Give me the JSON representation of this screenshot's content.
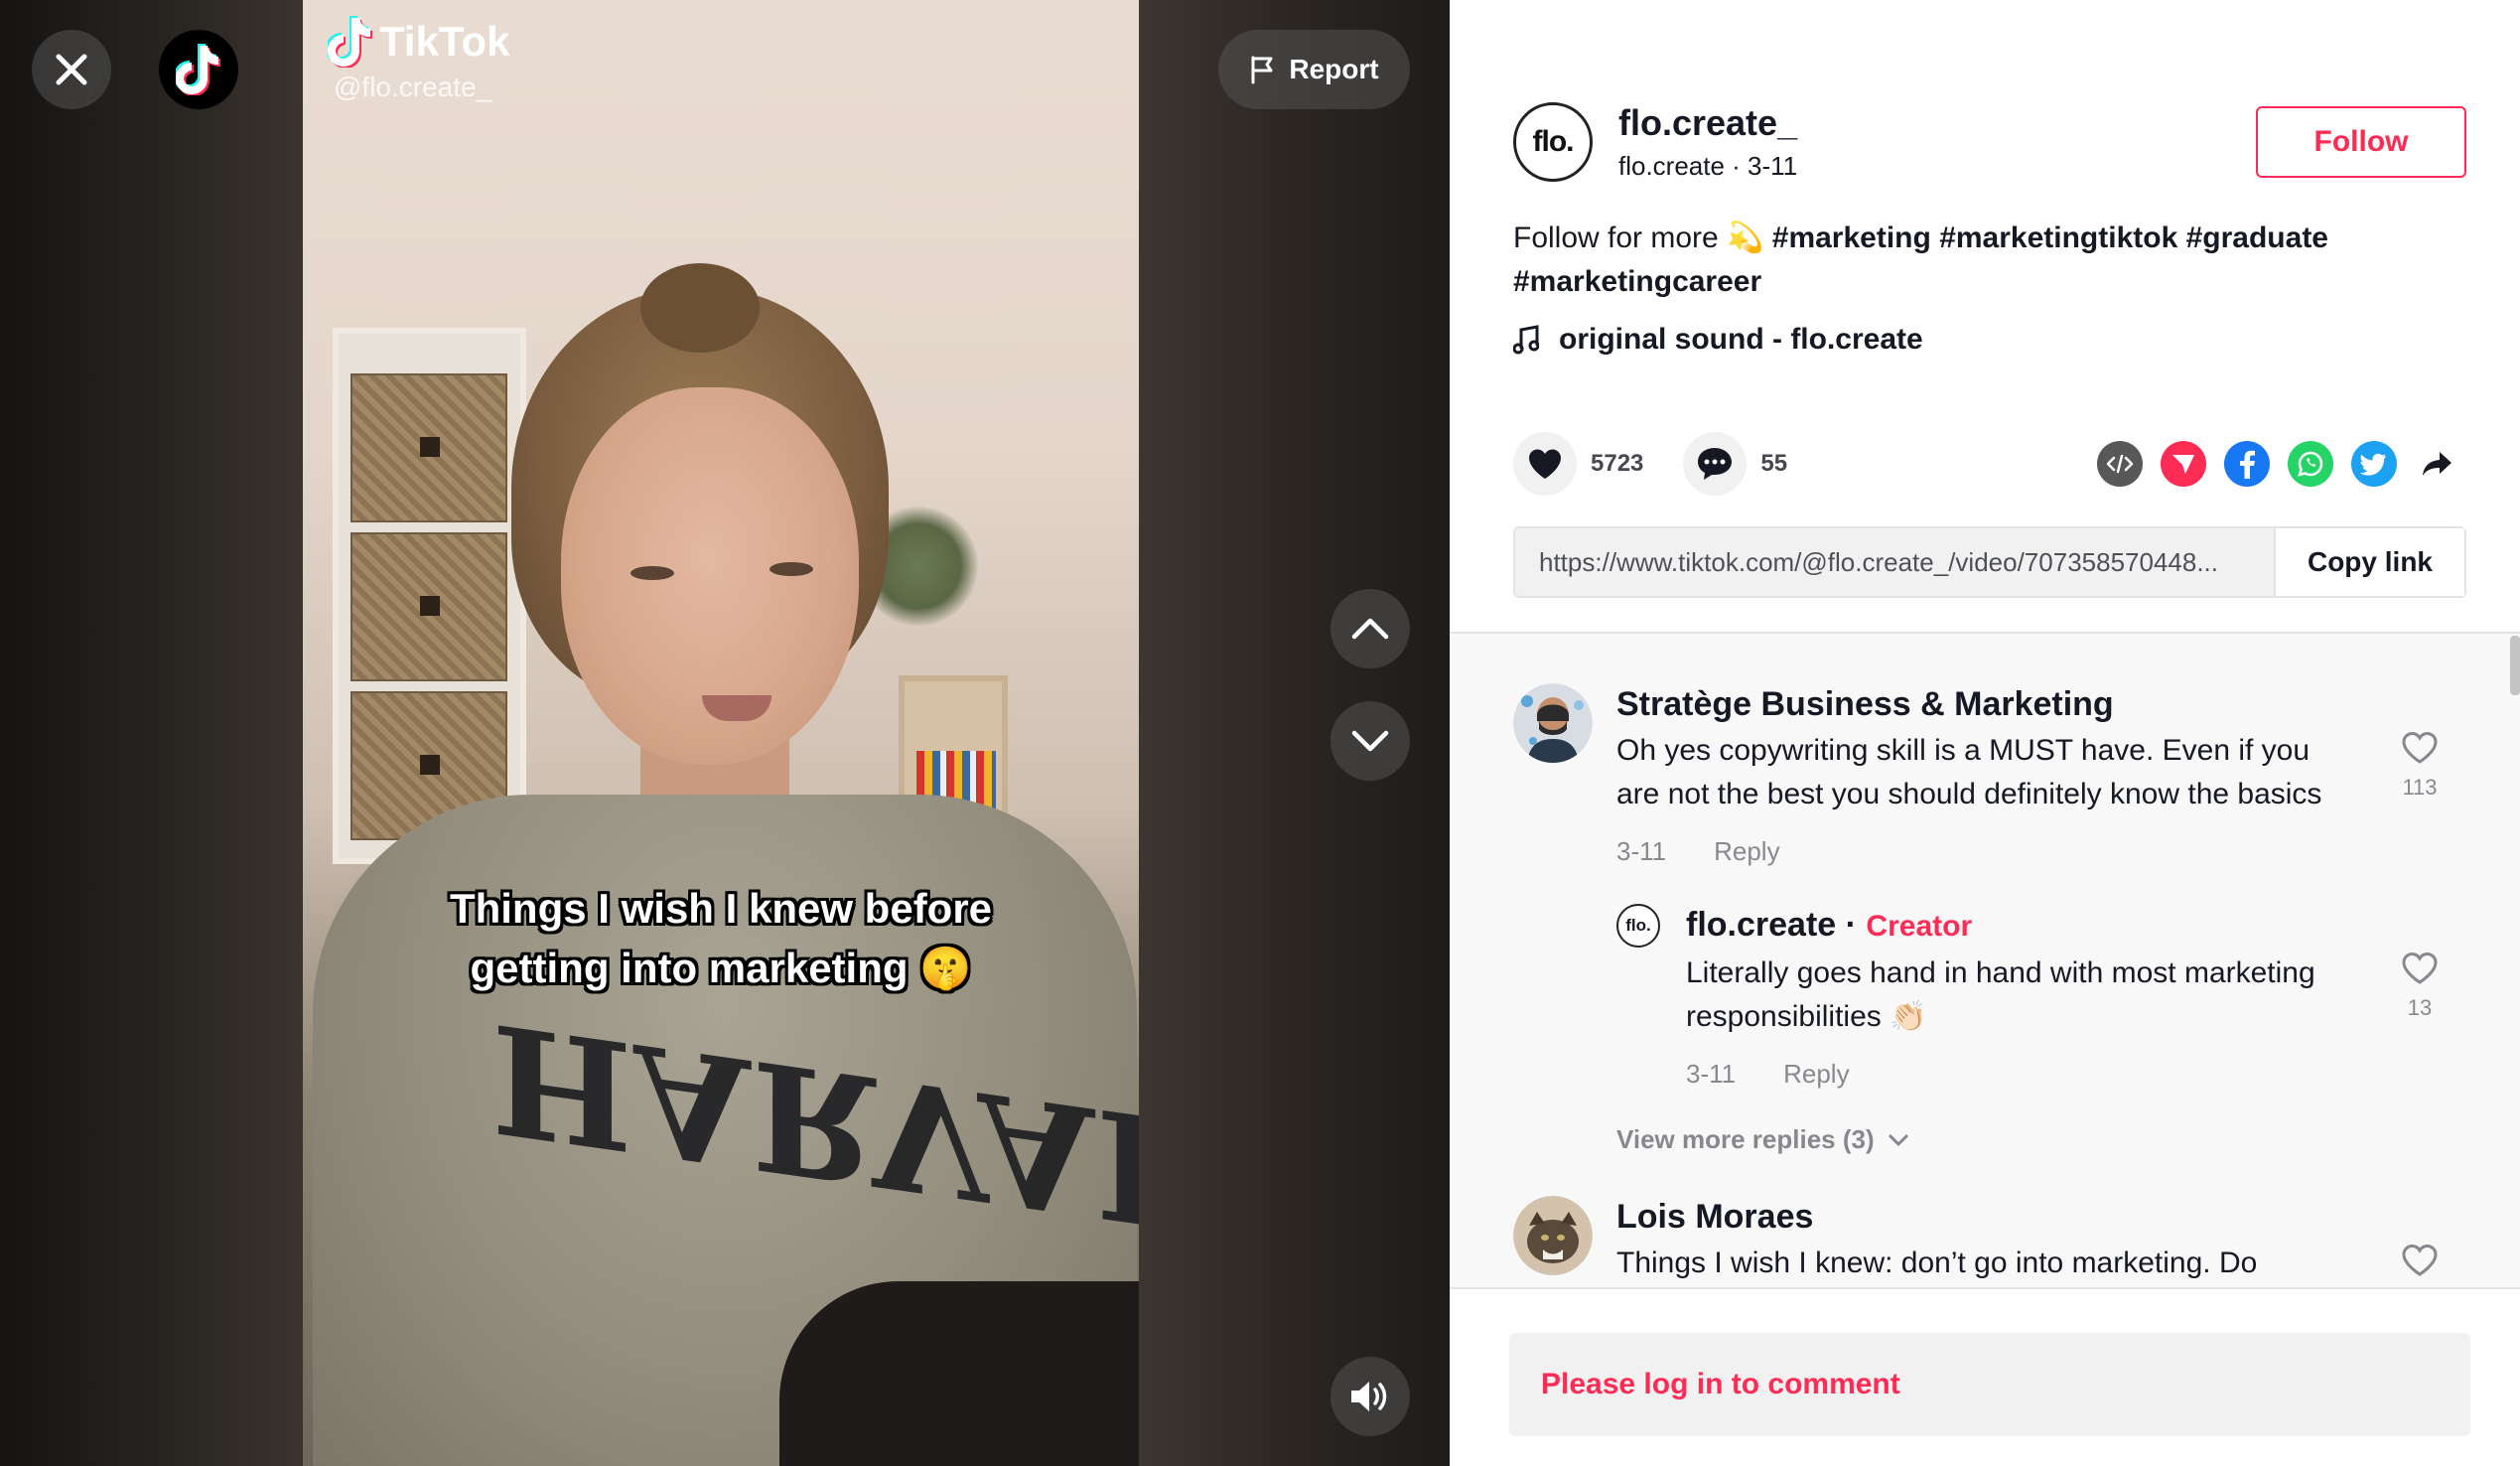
{
  "video": {
    "watermark_brand": "TikTok",
    "watermark_user": "@flo.create_",
    "caption_line1": "Things I wish I knew before",
    "caption_line2": "getting into marketing 🤫",
    "report_label": "Report"
  },
  "author": {
    "avatar_text": "flo.",
    "username": "flo.create_",
    "subline": "flo.create · 3-11",
    "follow_label": "Follow"
  },
  "description": {
    "text": "Follow for more 💫",
    "hashtags": [
      "#marketing",
      "#marketingtiktok",
      "#graduate",
      "#marketingcareer"
    ]
  },
  "sound": {
    "label": "original sound - flo.create"
  },
  "stats": {
    "likes": "5723",
    "comments": "55"
  },
  "share_icons": [
    "embed-icon",
    "send-icon",
    "facebook-icon",
    "whatsapp-icon",
    "twitter-icon",
    "share-arrow-icon"
  ],
  "link": {
    "url": "https://www.tiktok.com/@flo.create_/video/707358570448...",
    "copy_label": "Copy link"
  },
  "comments": [
    {
      "name": "Stratège Business & Marketing",
      "text_line1": "Oh yes copywriting skill is a MUST have. Even if you",
      "text_line2": "are not the best you should definitely know the basics",
      "date": "3-11",
      "reply_label": "Reply",
      "likes": "113"
    },
    {
      "name": "flo.create",
      "badge": "Creator",
      "avatar_text": "flo.",
      "text_line1": "Literally goes hand in hand with most marketing",
      "text_line2": "responsibilities 👏🏻",
      "date": "3-11",
      "reply_label": "Reply",
      "likes": "13"
    },
    {
      "name": "Lois Moraes",
      "text_line1": "Things I wish I knew: don’t go into marketing. Do"
    }
  ],
  "view_more_label": "View more replies (3)",
  "login_prompt": "Please log in to comment",
  "colors": {
    "accent": "#fe2c55",
    "facebook": "#1877f2",
    "whatsapp": "#25d366",
    "twitter": "#1da1f2",
    "send": "#fe2c55",
    "embed": "#585858"
  }
}
